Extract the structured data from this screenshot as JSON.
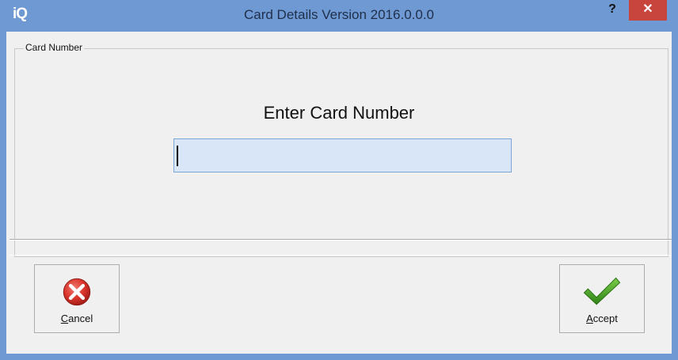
{
  "window": {
    "app_icon_text": "iQ",
    "title": "Card Details Version 2016.0.0.0",
    "help_label": "?",
    "close_label": "✕"
  },
  "group": {
    "label": "Card Number"
  },
  "form": {
    "prompt": "Enter Card Number",
    "card_number_value": "",
    "card_number_placeholder": ""
  },
  "buttons": {
    "cancel": {
      "underlined_letter": "C",
      "rest": "ancel",
      "icon": "cancel-x-icon"
    },
    "accept": {
      "underlined_letter": "A",
      "rest": "ccept",
      "icon": "check-mark-icon"
    }
  },
  "colors": {
    "titlebar": "#6f99d3",
    "close_button": "#c7453c",
    "input_background": "#d8e6f7",
    "cancel_icon_red": "#d9342b",
    "accept_icon_green": "#3c9a1e"
  }
}
